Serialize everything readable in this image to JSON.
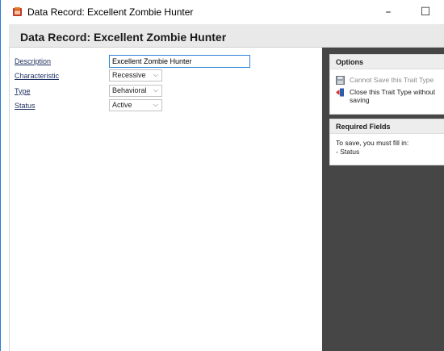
{
  "window": {
    "title": "Data Record: Excellent Zombie Hunter",
    "minimize_glyph": "–",
    "maximize_glyph": "☐",
    "close_glyph": "✕"
  },
  "header": {
    "title": "Data Record: Excellent Zombie Hunter"
  },
  "form": {
    "fields": [
      {
        "label": "Description",
        "value": "Excellent Zombie Hunter",
        "kind": "text"
      },
      {
        "label": "Characteristic",
        "value": "Recessive",
        "kind": "select"
      },
      {
        "label": "Type",
        "value": "Behavioral",
        "kind": "select"
      },
      {
        "label": "Status",
        "value": "Active",
        "kind": "select"
      }
    ]
  },
  "options_panel": {
    "title": "Options",
    "items": [
      {
        "label": "Cannot Save this Trait Type",
        "icon": "save-disk-icon",
        "enabled": false
      },
      {
        "label": "Close this Trait Type without saving",
        "icon": "close-door-icon",
        "enabled": true
      }
    ]
  },
  "required_panel": {
    "title": "Required Fields",
    "line1": "To save, you must fill in:",
    "line2": "- Status"
  },
  "colors": {
    "right_panel_bg": "#464646",
    "input_focus_border": "#2e83d8",
    "label_color": "#1c2d5e"
  }
}
